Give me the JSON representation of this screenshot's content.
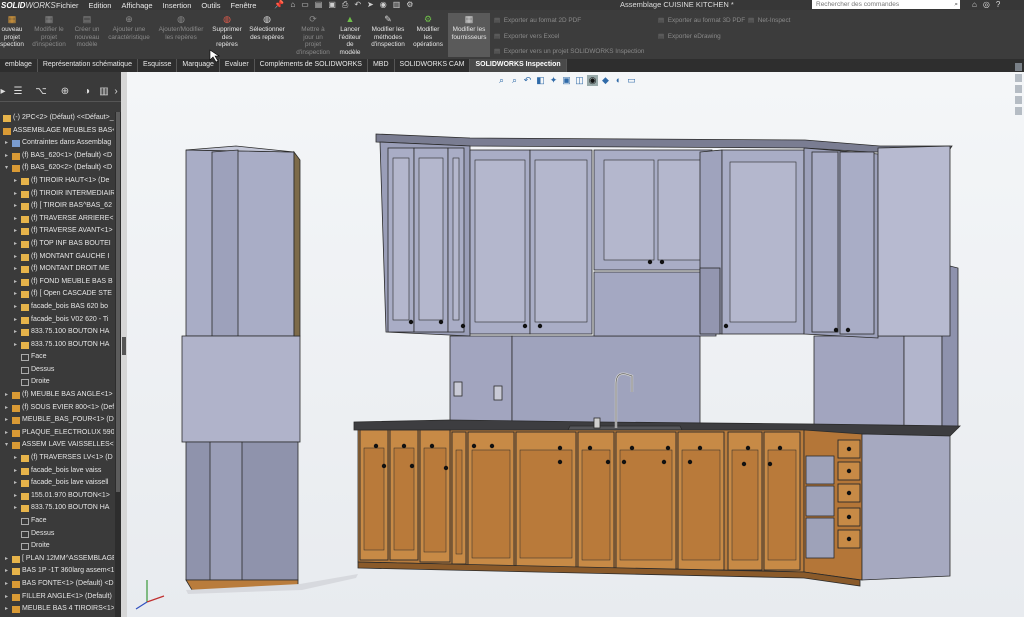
{
  "app": {
    "logo_1": "SOLID",
    "logo_2": "WORKS",
    "doc_title": "Assemblage CUISINE KITCHEN *"
  },
  "menu": {
    "items": [
      "Fichier",
      "Edition",
      "Affichage",
      "Insertion",
      "Outils",
      "Fenêtre"
    ],
    "search_placeholder": "Rechercher des commandes"
  },
  "ribbon": {
    "buttons": [
      {
        "l1": "ouveau",
        "l2": "projet",
        "l3": "spection",
        "icon": "new-project-icon",
        "enabled": true
      },
      {
        "l1": "Modifier le",
        "l2": "projet",
        "l3": "d'inspection",
        "icon": "edit-project-icon",
        "enabled": false
      },
      {
        "l1": "Créer un",
        "l2": "nouveau",
        "l3": "modèle",
        "icon": "new-template-icon",
        "enabled": false
      },
      {
        "l1": "Ajouter une",
        "l2": "caractéristique",
        "l3": "",
        "icon": "add-characteristic-icon",
        "enabled": false
      },
      {
        "l1": "Ajouter/Modifier",
        "l2": "les repères",
        "l3": "",
        "icon": "balloons-icon",
        "enabled": false
      },
      {
        "l1": "Supprimer",
        "l2": "des",
        "l3": "repères",
        "l4": "",
        "icon": "delete-balloons-icon",
        "enabled": true
      },
      {
        "l1": "Sélectionner",
        "l2": "des repères",
        "l3": "",
        "icon": "select-balloons-icon",
        "enabled": true
      },
      {
        "l1": "Mettre à",
        "l2": "jour un",
        "l3": "projet",
        "l4": "d'inspection",
        "icon": "update-project-icon",
        "enabled": false
      },
      {
        "l1": "Lancer",
        "l2": "l'éditeur",
        "l3": "de",
        "l4": "modèle",
        "icon": "template-editor-icon",
        "enabled": true
      },
      {
        "l1": "Modifier les",
        "l2": "méthodes",
        "l3": "d'inspection",
        "icon": "inspection-methods-icon",
        "enabled": true
      },
      {
        "l1": "Modifier",
        "l2": "les",
        "l3": "opérations",
        "icon": "operations-icon",
        "enabled": true
      },
      {
        "l1": "Modifier les",
        "l2": "fournisseurs",
        "l3": "",
        "icon": "vendors-icon",
        "enabled": true
      }
    ],
    "export_2d": "Exporter au format 2D PDF",
    "export_excel": "Exporter vers Excel",
    "export_project": "Exporter vers un projet SOLIDWORKS Inspection",
    "export_3d": "Exporter au format 3D PDF",
    "export_edrawing": "Exporter eDrawing",
    "net_inspect": "Net-Inspect"
  },
  "tabs": [
    "emblage",
    "Représentation schématique",
    "Esquisse",
    "Marquage",
    "Evaluer",
    "Compléments de SOLIDWORKS",
    "MBD",
    "SOLIDWORKS CAM",
    "SOLIDWORKS Inspection"
  ],
  "active_tab": "SOLIDWORKS Inspection",
  "tree": [
    {
      "level": 0,
      "arrow": "",
      "type": "part",
      "label": "(-) 2PC<2> (Défaut) <<Défaut>_"
    },
    {
      "level": 0,
      "arrow": "",
      "type": "assembly",
      "label": "ASSEMBLAGE MEUBLES BAS<1>"
    },
    {
      "level": 1,
      "arrow": "▸",
      "type": "mates",
      "label": "Contraintes dans Assemblag"
    },
    {
      "level": 1,
      "arrow": "▸",
      "type": "assembly",
      "label": "(f) BAS_620<1> (Default) <D"
    },
    {
      "level": 1,
      "arrow": "▾",
      "type": "assembly",
      "label": "(f) BAS_620<2> (Default) <D"
    },
    {
      "level": 2,
      "arrow": "▸",
      "type": "part",
      "label": "(f) TIROIR HAUT<1> (De"
    },
    {
      "level": 2,
      "arrow": "▸",
      "type": "part",
      "label": "(f) TIROIR INTERMEDIAIR"
    },
    {
      "level": 2,
      "arrow": "▸",
      "type": "part",
      "label": "(f) [ TIROIR BAS^BAS_62"
    },
    {
      "level": 2,
      "arrow": "▸",
      "type": "part",
      "label": "(f) TRAVERSE ARRIERE<"
    },
    {
      "level": 2,
      "arrow": "▸",
      "type": "part",
      "label": "(f) TRAVERSE AVANT<1>"
    },
    {
      "level": 2,
      "arrow": "▸",
      "type": "part",
      "label": "(f) TOP INF BAS BOUTEI"
    },
    {
      "level": 2,
      "arrow": "▸",
      "type": "part",
      "label": "(f) MONTANT GAUCHE I"
    },
    {
      "level": 2,
      "arrow": "▸",
      "type": "part",
      "label": "(f) MONTANT DROIT ME"
    },
    {
      "level": 2,
      "arrow": "▸",
      "type": "part",
      "label": "(f) FOND MEUBLE BAS B"
    },
    {
      "level": 2,
      "arrow": "▸",
      "type": "part",
      "label": "(f) [ Open CASCADE STE"
    },
    {
      "level": 2,
      "arrow": "▸",
      "type": "part",
      "label": "facade_bois BAS 620 bo"
    },
    {
      "level": 2,
      "arrow": "▸",
      "type": "part",
      "label": "facade_bois V02 620 - Ti"
    },
    {
      "level": 2,
      "arrow": "▸",
      "type": "part",
      "label": "833.75.100 BOUTON HA"
    },
    {
      "level": 2,
      "arrow": "▸",
      "type": "part",
      "label": "833.75.100 BOUTON HA"
    },
    {
      "level": 2,
      "arrow": "",
      "type": "plane",
      "label": "Face"
    },
    {
      "level": 2,
      "arrow": "",
      "type": "plane",
      "label": "Dessus"
    },
    {
      "level": 2,
      "arrow": "",
      "type": "plane",
      "label": "Droite"
    },
    {
      "level": 1,
      "arrow": "▸",
      "type": "assembly",
      "label": "(f) MEUBLE BAS ANGLE<1>"
    },
    {
      "level": 1,
      "arrow": "▸",
      "type": "assembly",
      "label": "(f) SOUS EVIER 800<1> (Defa"
    },
    {
      "level": 1,
      "arrow": "▸",
      "type": "assembly",
      "label": "MEUBLE_BAS_FOUR<1> (Def"
    },
    {
      "level": 1,
      "arrow": "▸",
      "type": "assembly",
      "label": "PLAQUE_ELECTROLUX 590x5"
    },
    {
      "level": 1,
      "arrow": "▾",
      "type": "assembly",
      "label": "ASSEM LAVE VAISSELLES<1>"
    },
    {
      "level": 2,
      "arrow": "▸",
      "type": "part",
      "label": "(f) TRAVERSES LV<1> (D"
    },
    {
      "level": 2,
      "arrow": "▸",
      "type": "part",
      "label": "facade_bois lave vaiss"
    },
    {
      "level": 2,
      "arrow": "▸",
      "type": "part",
      "label": "facade_bois lave vaissell"
    },
    {
      "level": 2,
      "arrow": "▸",
      "type": "part",
      "label": "155.01.970 BOUTON<1>"
    },
    {
      "level": 2,
      "arrow": "▸",
      "type": "part",
      "label": "833.75.100 BOUTON HA"
    },
    {
      "level": 2,
      "arrow": "",
      "type": "plane",
      "label": "Face"
    },
    {
      "level": 2,
      "arrow": "",
      "type": "plane",
      "label": "Dessus"
    },
    {
      "level": 2,
      "arrow": "",
      "type": "plane",
      "label": "Droite"
    },
    {
      "level": 1,
      "arrow": "▸",
      "type": "part",
      "label": "[ PLAN 12MM^ASSEMBLAGE"
    },
    {
      "level": 1,
      "arrow": "▸",
      "type": "part",
      "label": "BAS 1P -1T 360larg assem<1"
    },
    {
      "level": 1,
      "arrow": "▸",
      "type": "assembly",
      "label": "BAS FONTE<1> (Default) <D"
    },
    {
      "level": 1,
      "arrow": "▸",
      "type": "assembly",
      "label": "FILLER ANGLE<1> (Default)"
    },
    {
      "level": 1,
      "arrow": "▸",
      "type": "assembly",
      "label": "MEUBLE BAS 4 TIROIRS<1>"
    }
  ],
  "colors": {
    "accent": "#2f6aa8",
    "cabinet": "#a9adc6",
    "wood": "#b97c3c",
    "counter": "#3d3d40",
    "wall": "#9fa3bd"
  },
  "view_tools": [
    "zoom-fit-icon",
    "zoom-area-icon",
    "previous-view-icon",
    "section-view-icon",
    "dynamic-annotation-icon",
    "view-orientation-icon",
    "display-style-icon",
    "hide-show-icon",
    "edit-appearance-icon",
    "apply-scene-icon",
    "view-settings-icon"
  ]
}
